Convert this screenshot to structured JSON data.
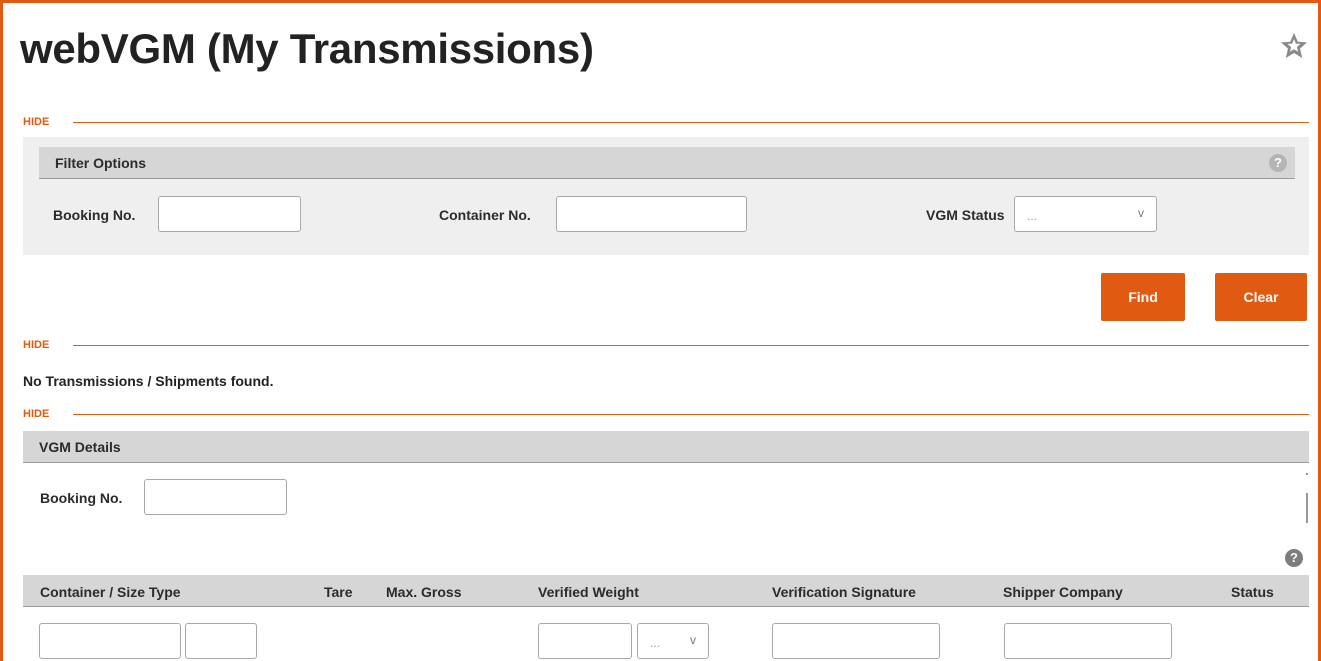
{
  "page": {
    "title": "webVGM (My Transmissions)"
  },
  "sections": {
    "hide_label": "HIDE"
  },
  "filter": {
    "heading": "Filter Options",
    "booking_label": "Booking No.",
    "booking_value": "",
    "container_label": "Container No.",
    "container_value": "",
    "status_label": "VGM Status",
    "status_selected": "..."
  },
  "buttons": {
    "find": "Find",
    "clear": "Clear"
  },
  "results": {
    "message": "No Transmissions / Shipments found."
  },
  "vgm_details": {
    "heading": "VGM Details",
    "booking_label": "Booking No.",
    "booking_value": "",
    "columns": [
      "Container / Size Type",
      "Tare",
      "Max. Gross",
      "Verified Weight",
      "Verification Signature",
      "Shipper Company",
      "Status"
    ],
    "weight_unit_selected": "..."
  },
  "icons": {
    "help": "?",
    "star": "star-icon"
  },
  "colors": {
    "accent": "#e05a12",
    "panel": "#efefef",
    "header": "#d6d6d6"
  }
}
